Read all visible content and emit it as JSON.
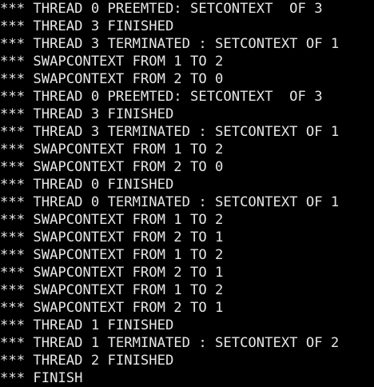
{
  "terminal": {
    "lines": [
      "*** THREAD 0 PREEMTED: SETCONTEXT  OF 3",
      "*** THREAD 3 FINISHED",
      "*** THREAD 3 TERMINATED : SETCONTEXT OF 1",
      "*** SWAPCONTEXT FROM 1 TO 2",
      "*** SWAPCONTEXT FROM 2 TO 0",
      "*** THREAD 0 PREEMTED: SETCONTEXT  OF 3",
      "*** THREAD 3 FINISHED",
      "*** THREAD 3 TERMINATED : SETCONTEXT OF 1",
      "*** SWAPCONTEXT FROM 1 TO 2",
      "*** SWAPCONTEXT FROM 2 TO 0",
      "*** THREAD 0 FINISHED",
      "*** THREAD 0 TERMINATED : SETCONTEXT OF 1",
      "*** SWAPCONTEXT FROM 1 TO 2",
      "*** SWAPCONTEXT FROM 2 TO 1",
      "*** SWAPCONTEXT FROM 1 TO 2",
      "*** SWAPCONTEXT FROM 2 TO 1",
      "*** SWAPCONTEXT FROM 1 TO 2",
      "*** SWAPCONTEXT FROM 2 TO 1",
      "*** THREAD 1 FINISHED",
      "*** THREAD 1 TERMINATED : SETCONTEXT OF 2",
      "*** THREAD 2 FINISHED",
      "*** FINISH"
    ]
  }
}
